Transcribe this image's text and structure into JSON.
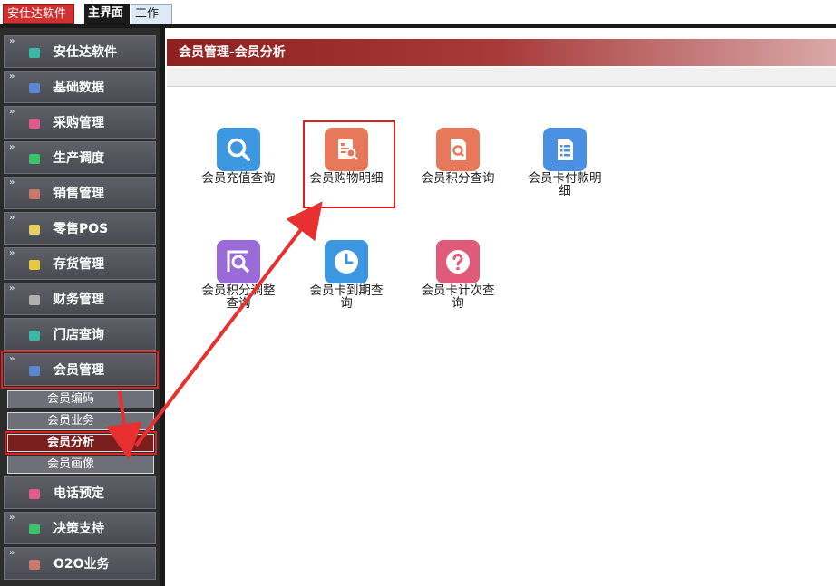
{
  "topbar": {
    "app_name": "安仕达软件",
    "tabs": [
      {
        "label": "主界面"
      },
      {
        "label": "工作台"
      }
    ]
  },
  "sidebar": {
    "items": [
      {
        "label": "安仕达软件",
        "icon": "teal-square-icon",
        "color": "#3bb8a8"
      },
      {
        "label": "基础数据",
        "icon": "blue-square-icon",
        "color": "#5a86d6"
      },
      {
        "label": "采购管理",
        "icon": "pink-square-icon",
        "color": "#e05a8a"
      },
      {
        "label": "生产调度",
        "icon": "green-square-icon",
        "color": "#3ac46a"
      },
      {
        "label": "销售管理",
        "icon": "brown-square-icon",
        "color": "#c87a6a"
      },
      {
        "label": "零售POS",
        "icon": "yellow-square-icon",
        "color": "#e8d060"
      },
      {
        "label": "存货管理",
        "icon": "yellow-square-icon",
        "color": "#e8c840"
      },
      {
        "label": "财务管理",
        "icon": "gray-square-icon",
        "color": "#b0b0b0"
      },
      {
        "label": "门店查询",
        "icon": "teal-square-icon",
        "color": "#3bb8a8"
      },
      {
        "label": "会员管理",
        "icon": "blue-square-icon",
        "color": "#5a86d6"
      }
    ],
    "sub_items": [
      {
        "label": "会员编码"
      },
      {
        "label": "会员业务"
      },
      {
        "label": "会员分析"
      },
      {
        "label": "会员画像"
      }
    ],
    "items_after": [
      {
        "label": "电话预定",
        "icon": "pink-square-icon",
        "color": "#e05a8a"
      },
      {
        "label": "决策支持",
        "icon": "green-square-icon",
        "color": "#3ac46a"
      },
      {
        "label": "O2O业务",
        "icon": "brown-square-icon",
        "color": "#c87a6a"
      }
    ]
  },
  "main": {
    "title": "会员管理-会员分析",
    "tiles": [
      {
        "label": "会员充值查询",
        "icon": "search-icon",
        "color": "#3d96e0"
      },
      {
        "label": "会员购物明细",
        "icon": "receipt-search-icon",
        "color": "#e8785a"
      },
      {
        "label": "会员积分查询",
        "icon": "document-search-icon",
        "color": "#e8785a"
      },
      {
        "label": "会员卡付款明细",
        "icon": "list-document-icon",
        "color": "#4a90e2"
      },
      {
        "label": "会员积分调整查询",
        "icon": "magnifier-frame-icon",
        "color": "#9a6ad8"
      },
      {
        "label": "会员卡到期查询",
        "icon": "clock-icon",
        "color": "#3d96e0"
      },
      {
        "label": "会员卡计次查询",
        "icon": "question-icon",
        "color": "#e05a7a"
      }
    ]
  },
  "colors": {
    "accent_red": "#e02020",
    "title_bar": "#8e2020"
  }
}
